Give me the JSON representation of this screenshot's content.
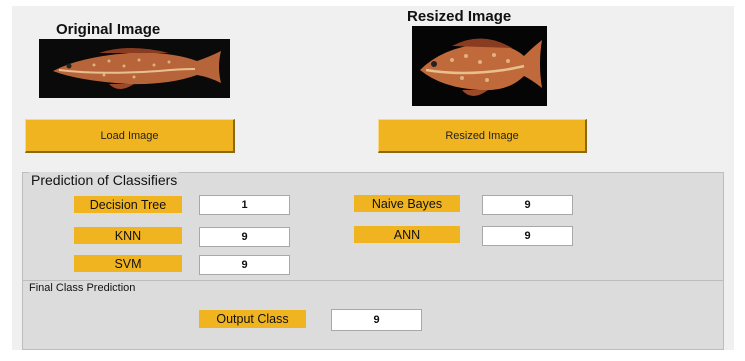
{
  "images": {
    "original_title": "Original Image",
    "resized_title": "Resized Image",
    "original_icon": "fish-photo",
    "resized_icon": "fish-photo"
  },
  "buttons": {
    "load_label": "Load Image",
    "resize_label": "Resized Image"
  },
  "prediction_panel": {
    "title": "Prediction of Classifiers",
    "classifiers": [
      {
        "label": "Decision Tree",
        "value": "1"
      },
      {
        "label": "Naive Bayes",
        "value": "9"
      },
      {
        "label": "KNN",
        "value": "9"
      },
      {
        "label": "ANN",
        "value": "9"
      },
      {
        "label": "SVM",
        "value": "9"
      }
    ]
  },
  "final_panel": {
    "title": "Final Class Prediction",
    "output_label": "Output Class",
    "output_value": "9"
  },
  "colors": {
    "accent": "#f0b420",
    "panel": "#dcdcdc",
    "window": "#f0f0f0"
  }
}
